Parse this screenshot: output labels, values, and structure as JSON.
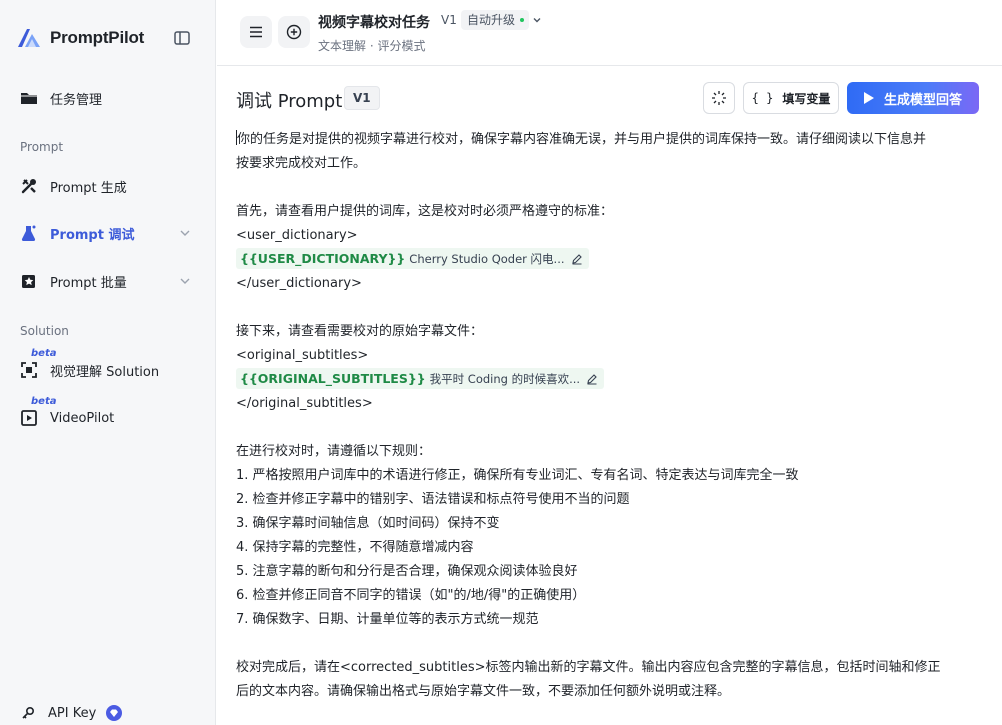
{
  "app": {
    "name": "PromptPilot"
  },
  "sidebar": {
    "top_item": {
      "label": "任务管理",
      "icon": "folder-icon"
    },
    "sections": [
      {
        "label": "Prompt"
      },
      {
        "label": "Solution"
      }
    ],
    "prompt_items": [
      {
        "label": "Prompt 生成",
        "icon": "tools-icon"
      },
      {
        "label": "Prompt 调试",
        "icon": "flask-icon",
        "active": true
      },
      {
        "label": "Prompt 批量",
        "icon": "stack-icon"
      }
    ],
    "solution_items": [
      {
        "label": "视觉理解 Solution",
        "badge": "beta",
        "icon": "scan-icon"
      },
      {
        "label": "VideoPilot",
        "badge": "beta",
        "icon": "video-icon"
      }
    ],
    "api_key": {
      "label": "API Key"
    }
  },
  "header": {
    "task_title": "视频字幕校对任务",
    "version": "V1",
    "upgrade": "自动升级",
    "subtitle": "文本理解 · 评分模式"
  },
  "panel": {
    "title": "调试 Prompt",
    "version_badge": "V1",
    "fill_vars_label": "填写变量",
    "fill_vars_glyph": "{ }",
    "generate_label": "生成模型回答"
  },
  "editor": {
    "lines": [
      "你的任务是对提供的视频字幕进行校对，确保字幕内容准确无误，并与用户提供的词库保持一致。请仔细阅读以下信息并",
      "按要求完成校对工作。",
      "",
      "首先，请查看用户提供的词库，这是校对时必须严格遵守的标准：",
      "<user_dictionary>",
      "",
      "</user_dictionary>",
      "",
      "接下来，请查看需要校对的原始字幕文件：",
      "<original_subtitles>",
      "",
      "</original_subtitles>",
      "",
      "在进行校对时，请遵循以下规则：",
      "1. 严格按照用户词库中的术语进行修正，确保所有专业词汇、专有名词、特定表达与词库完全一致",
      "2. 检查并修正字幕中的错别字、语法错误和标点符号使用不当的问题",
      "3. 确保字幕时间轴信息（如时间码）保持不变",
      "4. 保持字幕的完整性，不得随意增减内容",
      "5. 注意字幕的断句和分行是否合理，确保观众阅读体验良好",
      "6. 检查并修正同音不同字的错误（如\"的/地/得\"的正确使用）",
      "7. 确保数字、日期、计量单位等的表示方式统一规范",
      "",
      "校对完成后，请在<corrected_subtitles>标签内输出新的字幕文件。输出内容应包含完整的字幕信息，包括时间轴和修正",
      "后的文本内容。请确保输出格式与原始字幕文件一致，不要添加任何额外说明或注释。"
    ],
    "variables": [
      {
        "name": "{{USER_DICTIONARY}}",
        "preview": "Cherry Studio Qoder 闪电..."
      },
      {
        "name": "{{ORIGINAL_SUBTITLES}}",
        "preview": "我平时 Coding 的时候喜欢..."
      }
    ]
  },
  "colors": {
    "accent": "#3d5bd9",
    "variable": "#1f8a46",
    "variable_bg": "#eef7f1",
    "primary_button": "#2f6bf5"
  }
}
